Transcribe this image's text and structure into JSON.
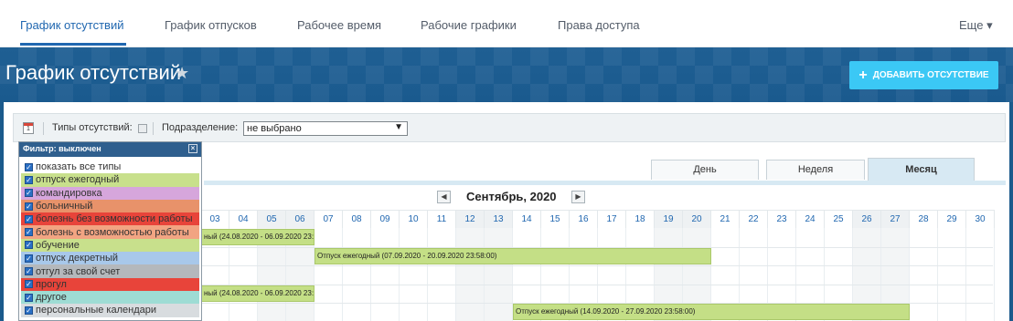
{
  "topnav": {
    "tabs": [
      {
        "label": "График отсутствий"
      },
      {
        "label": "График отпусков"
      },
      {
        "label": "Рабочее время"
      },
      {
        "label": "Рабочие графики"
      },
      {
        "label": "Права доступа"
      }
    ],
    "more_label": "Еще ▾",
    "accent_color": "#2067b0"
  },
  "header": {
    "title": "График отсутствий",
    "star_icon": "star-icon",
    "add_button_label": "ДОБАВИТЬ ОТСУТСТВИЕ",
    "add_button_color": "#3bc8f5"
  },
  "filter_bar": {
    "types_label": "Типы отсутствий:",
    "dept_label": "Подразделение:",
    "dept_value": "не выбрано"
  },
  "filter_popup": {
    "title": "Фильтр: выключен",
    "close_icon": "close-icon",
    "types": [
      {
        "label": "показать все типы",
        "color": "#ffffff",
        "checked": true
      },
      {
        "label": "отпуск ежегодный",
        "color": "#c8e08c",
        "checked": true
      },
      {
        "label": "командировка",
        "color": "#d6a6dc",
        "checked": true
      },
      {
        "label": "больничный",
        "color": "#e8926a",
        "checked": true
      },
      {
        "label": "болезнь без возможности работы",
        "color": "#e8443a",
        "checked": true
      },
      {
        "label": "болезнь с возможностью работы",
        "color": "#f2a482",
        "checked": true
      },
      {
        "label": "обучение",
        "color": "#c8e08c",
        "checked": true
      },
      {
        "label": "отпуск декретный",
        "color": "#a8c8ea",
        "checked": true
      },
      {
        "label": "отгул за свой счет",
        "color": "#b4b8bc",
        "checked": true
      },
      {
        "label": "прогул",
        "color": "#e8443a",
        "checked": true
      },
      {
        "label": "другое",
        "color": "#9edcd4",
        "checked": true
      },
      {
        "label": "персональные календари",
        "color": "#d8dcdf",
        "checked": true
      }
    ]
  },
  "view_tabs": {
    "day": "День",
    "week": "Неделя",
    "month": "Месяц",
    "active": "month"
  },
  "calendar": {
    "month_label": "Сентябрь, 2020",
    "prev_icon": "prev-month-icon",
    "next_icon": "next-month-icon",
    "days": [
      "03",
      "04",
      "05",
      "06",
      "07",
      "08",
      "09",
      "10",
      "11",
      "12",
      "13",
      "14",
      "15",
      "16",
      "17",
      "18",
      "19",
      "20",
      "21",
      "22",
      "23",
      "24",
      "25",
      "26",
      "27",
      "28",
      "29",
      "30"
    ],
    "weekend_days": [
      "05",
      "06",
      "12",
      "13",
      "19",
      "20",
      "26",
      "27"
    ],
    "bars": [
      {
        "text": "ный (24.08.2020 - 06.09.2020 23:58:00)",
        "row": 0,
        "from_day": "01",
        "to_day": "06"
      },
      {
        "text": "Отпуск ежегодный (07.09.2020 - 20.09.2020 23:58:00)",
        "row": 1,
        "from_day": "07",
        "to_day": "20"
      },
      {
        "text": "ный (24.08.2020 - 06.09.2020 23:58:00)",
        "row": 3,
        "from_day": "01",
        "to_day": "06"
      },
      {
        "text": "Отпуск ежегодный (14.09.2020 - 27.09.2020 23:58:00)",
        "row": 4,
        "from_day": "14",
        "to_day": "27"
      }
    ]
  }
}
